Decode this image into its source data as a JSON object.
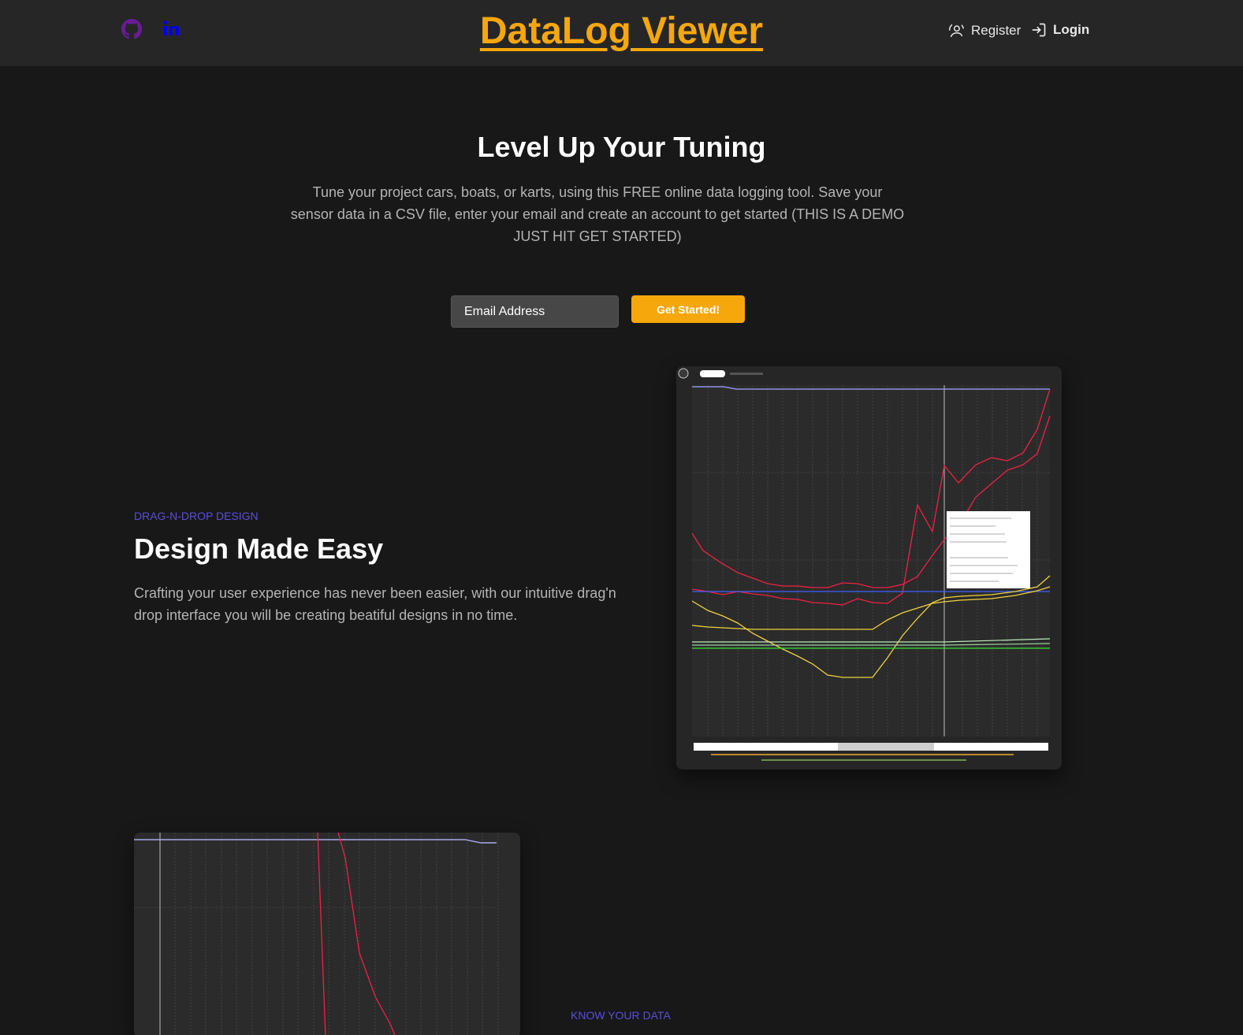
{
  "header": {
    "brand": "DataLog Viewer",
    "social": [
      {
        "icon": "github-icon",
        "color": "#6a1b9a"
      },
      {
        "icon": "linkedin-icon",
        "color": "#0000ee"
      }
    ],
    "nav": {
      "register_label": "Register",
      "login_label": "Login"
    }
  },
  "hero": {
    "title": "Level Up Your Tuning",
    "subtitle": "Tune your project cars, boats, or karts, using this FREE online data logging tool. Save your sensor data in a CSV file, enter your email and create an account to get started (THIS IS A DEMO JUST HIT GET STARTED)",
    "email_placeholder": "Email Address",
    "cta_label": "Get Started!"
  },
  "features": [
    {
      "eyebrow": "DRAG-N-DROP DESIGN",
      "title": "Design Made Easy",
      "body": "Crafting your user experience has never been easier, with our intuitive drag'n drop interface you will be creating beatiful designs in no time."
    },
    {
      "eyebrow": "KNOW YOUR DATA"
    }
  ],
  "colors": {
    "accent": "#f5a70c",
    "eyebrow": "#5b4fd6",
    "background": "#181818",
    "header": "#262626"
  }
}
